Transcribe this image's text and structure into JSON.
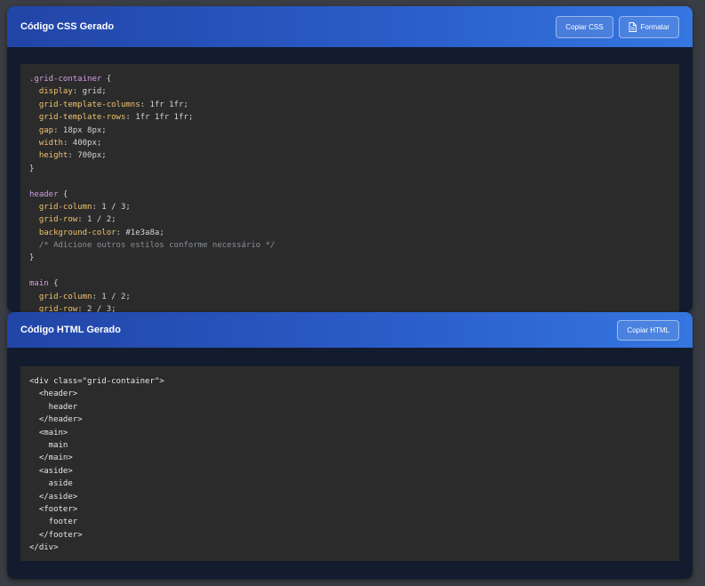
{
  "css_panel": {
    "title": "Código CSS Gerado",
    "copy_button": "Copiar CSS",
    "format_button": "Formatar",
    "code_lines": [
      [
        {
          "t": ".grid-container",
          "k": "sel"
        },
        {
          "t": " {",
          "k": "punc"
        }
      ],
      [
        {
          "t": "  display",
          "k": "prop"
        },
        {
          "t": ": grid;",
          "k": "val"
        }
      ],
      [
        {
          "t": "  grid-template-columns",
          "k": "prop"
        },
        {
          "t": ": 1fr 1fr;",
          "k": "val"
        }
      ],
      [
        {
          "t": "  grid-template-rows",
          "k": "prop"
        },
        {
          "t": ": 1fr 1fr 1fr;",
          "k": "val"
        }
      ],
      [
        {
          "t": "  gap",
          "k": "prop"
        },
        {
          "t": ": 18px 8px;",
          "k": "val"
        }
      ],
      [
        {
          "t": "  width",
          "k": "prop"
        },
        {
          "t": ": 400px;",
          "k": "val"
        }
      ],
      [
        {
          "t": "  height",
          "k": "prop"
        },
        {
          "t": ": 700px;",
          "k": "val"
        }
      ],
      [
        {
          "t": "}",
          "k": "punc"
        }
      ],
      [],
      [
        {
          "t": "header",
          "k": "sel"
        },
        {
          "t": " {",
          "k": "punc"
        }
      ],
      [
        {
          "t": "  grid-column",
          "k": "prop"
        },
        {
          "t": ": 1 / 3;",
          "k": "val"
        }
      ],
      [
        {
          "t": "  grid-row",
          "k": "prop"
        },
        {
          "t": ": 1 / 2;",
          "k": "val"
        }
      ],
      [
        {
          "t": "  background-color",
          "k": "prop"
        },
        {
          "t": ": #1e3a8a;",
          "k": "val"
        }
      ],
      [
        {
          "t": "  /* Adicione outros estilos conforme necessário */",
          "k": "comment"
        }
      ],
      [
        {
          "t": "}",
          "k": "punc"
        }
      ],
      [],
      [
        {
          "t": "main",
          "k": "sel"
        },
        {
          "t": " {",
          "k": "punc"
        }
      ],
      [
        {
          "t": "  grid-column",
          "k": "prop"
        },
        {
          "t": ": 1 / 2;",
          "k": "val"
        }
      ],
      [
        {
          "t": "  grid-row",
          "k": "prop"
        },
        {
          "t": ": 2 / 3;",
          "k": "val"
        }
      ]
    ]
  },
  "html_panel": {
    "title": "Código HTML Gerado",
    "copy_button": "Copiar HTML",
    "code_lines": [
      "<div class=\"grid-container\">",
      "  <header>",
      "    header",
      "  </header>",
      "  <main>",
      "    main",
      "  </main>",
      "  <aside>",
      "    aside",
      "  </aside>",
      "  <footer>",
      "    footer",
      "  </footer>",
      "</div>"
    ]
  },
  "colors": {
    "header_gradient_start": "#2245a6",
    "header_gradient_end": "#3576e0",
    "panel_bg": "#121c2e",
    "code_bg": "#2b2b2b",
    "selector": "#d19ee6",
    "property": "#f0c36d",
    "comment": "#8a8f98"
  },
  "icons": {
    "format_icon": "document-icon"
  }
}
